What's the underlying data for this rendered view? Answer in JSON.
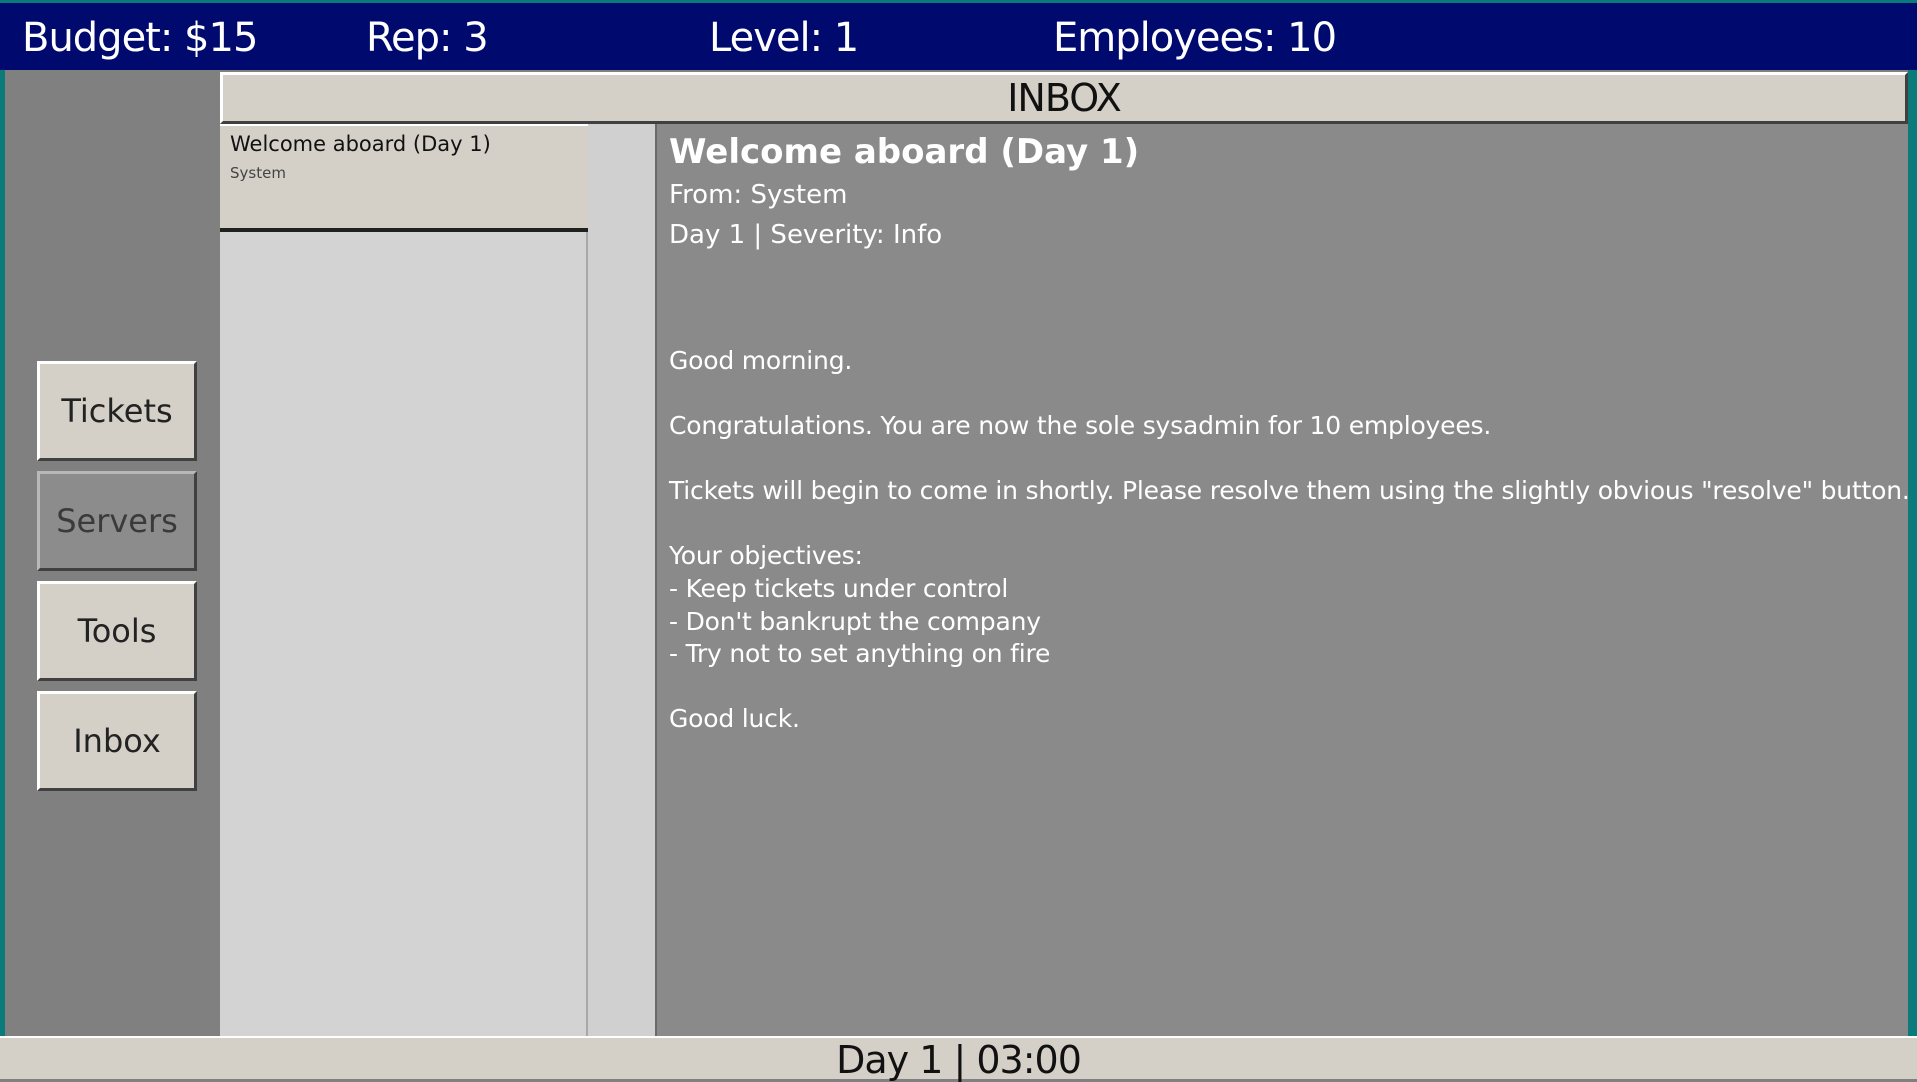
{
  "stats": {
    "budget": "Budget: $15",
    "rep": "Rep: 3",
    "level": "Level: 1",
    "employees": "Employees: 10"
  },
  "nav": {
    "tickets": "Tickets",
    "servers": "Servers",
    "tools": "Tools",
    "inbox": "Inbox"
  },
  "inbox": {
    "header": "INBOX",
    "messages": [
      {
        "subject": "Welcome aboard (Day 1)",
        "from": "System"
      }
    ]
  },
  "viewer": {
    "subject": "Welcome aboard (Day 1)",
    "from": "From: System",
    "meta": "Day 1  |  Severity: Info",
    "body": [
      "Good morning.",
      "Congratulations. You are now the sole sysadmin for 10 employees.",
      "Tickets will begin to come in shortly. Please resolve them using the slightly obvious \"resolve\" button.",
      "Your objectives:",
      "- Keep tickets under control",
      "- Don't bankrupt the company",
      "- Try not to set anything on fire",
      "Good luck."
    ]
  },
  "status": {
    "clock": "Day 1 | 03:00"
  },
  "colors": {
    "topbar": "#000a6e",
    "accent_edge": "#0a7a7a",
    "panel": "#d4d0c8",
    "viewer_bg": "#8a8a8a"
  }
}
